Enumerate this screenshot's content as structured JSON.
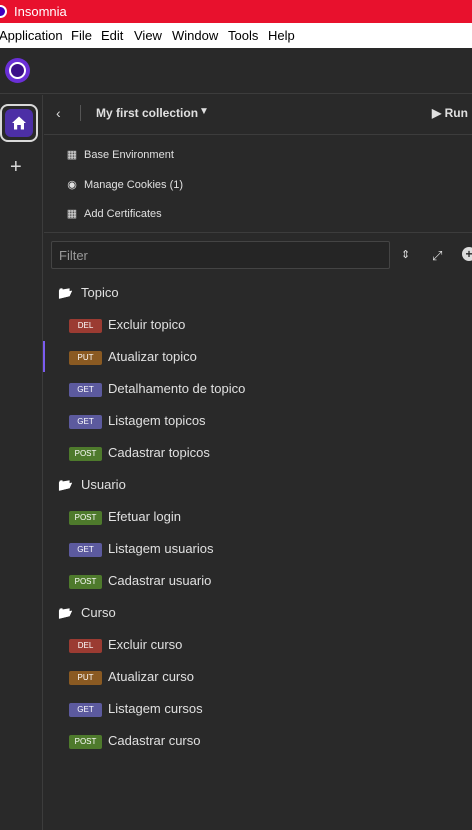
{
  "window": {
    "title": "Insomnia"
  },
  "menu": [
    "Application",
    "File",
    "Edit",
    "View",
    "Window",
    "Tools",
    "Help"
  ],
  "collection": {
    "title": "My first collection",
    "run_label": "Run"
  },
  "links": [
    {
      "label": "Base Environment",
      "icon": "document-icon"
    },
    {
      "label": "Manage Cookies (1)",
      "icon": "cookie-icon"
    },
    {
      "label": "Add Certificates",
      "icon": "certificate-icon"
    }
  ],
  "filter": {
    "placeholder": "Filter"
  },
  "colors": {
    "DEL": "#9b3b32",
    "PUT": "#8a5a22",
    "GET": "#5c5a9e",
    "POST": "#4e7a2c",
    "accent": "#7b5cf0",
    "titlebar": "#e8112d"
  },
  "tree": [
    {
      "folder": "Topico",
      "requests": [
        {
          "method": "DEL",
          "name": "Excluir topico"
        },
        {
          "method": "PUT",
          "name": "Atualizar topico"
        },
        {
          "method": "GET",
          "name": "Detalhamento de topico"
        },
        {
          "method": "GET",
          "name": "Listagem topicos"
        },
        {
          "method": "POST",
          "name": "Cadastrar topicos"
        }
      ]
    },
    {
      "folder": "Usuario",
      "requests": [
        {
          "method": "POST",
          "name": "Efetuar login"
        },
        {
          "method": "GET",
          "name": "Listagem usuarios"
        },
        {
          "method": "POST",
          "name": "Cadastrar usuario"
        }
      ]
    },
    {
      "folder": "Curso",
      "requests": [
        {
          "method": "DEL",
          "name": "Excluir curso"
        },
        {
          "method": "PUT",
          "name": "Atualizar curso"
        },
        {
          "method": "GET",
          "name": "Listagem cursos"
        },
        {
          "method": "POST",
          "name": "Cadastrar curso"
        }
      ]
    }
  ]
}
